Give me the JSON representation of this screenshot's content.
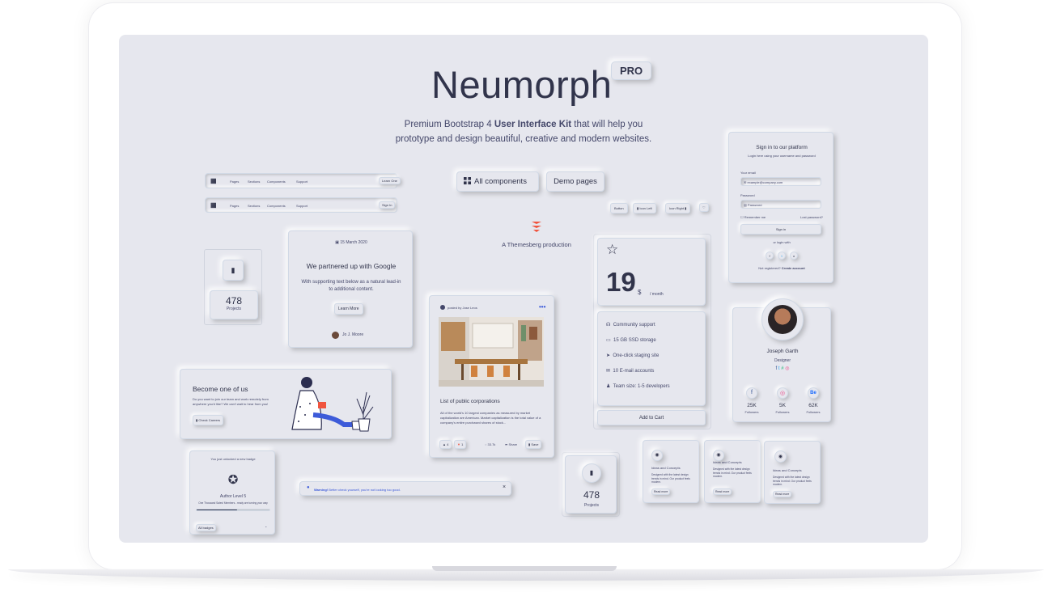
{
  "hero": {
    "title": "Neumorph",
    "badge": "PRO",
    "line1_a": "Premium Bootstrap 4 ",
    "line1_b": "User Interface Kit",
    "line1_c": " that will help you",
    "line2": "prototype and design beautiful, creative and modern websites."
  },
  "actions": {
    "all_components": "All components",
    "demo_pages": "Demo pages"
  },
  "navbar": {
    "items": [
      "Pages",
      "Sections",
      "Components",
      "Support"
    ],
    "learn": "Learn One",
    "signin": "Sign In"
  },
  "buttons": {
    "button": "Button",
    "icon_left": "Icon Left",
    "icon_right": "Icon Right"
  },
  "production": "A Themesberg production",
  "blog_card": {
    "date": "15 March 2020",
    "title": "We partnered up with Google",
    "text": "With supporting text below as a natural lead-in to additional content.",
    "cta": "Learn More",
    "author": "Jo J. Moore"
  },
  "counter": {
    "value": "478",
    "label": "Projects"
  },
  "careers": {
    "title": "Become one of us",
    "text": "Do you want to join our team and work remotely from anywhere you'd like? We can't wait to hear from you!",
    "cta": "Check Careers"
  },
  "post": {
    "by": "posted by Jose Leos",
    "title": "List of public corporations",
    "text": "All of the world's 10 largest companies as measured by market capitalization are American. Market capitalization is the total value of a company's entire purchased shares of stock...",
    "likes": "4",
    "dislikes": "1",
    "views": "33.7k",
    "share": "Share",
    "save": "Save"
  },
  "pricing": {
    "price": "19",
    "currency": "$",
    "period": "/ month",
    "features": [
      "Community support",
      "15 GB SSD storage",
      "One-click staging site",
      "10 E-mail accounts",
      "Team size: 1-5 developers"
    ],
    "cta": "Add to Cart"
  },
  "signin": {
    "title": "Sign in to our platform",
    "subtitle": "Login here using your username and password",
    "email_label": "Your email",
    "email_placeholder": "example@company.com",
    "password_label": "Password",
    "password_placeholder": "Password",
    "remember": "Remember me",
    "lost": "Lost password?",
    "submit": "Sign in",
    "or": "or login with",
    "not_registered": "Not registered?",
    "create": "Create account"
  },
  "profile": {
    "name": "Joseph Garth",
    "role": "Designer",
    "stats": [
      {
        "value": "25K",
        "label": "Followers"
      },
      {
        "value": "5K",
        "label": "Followers"
      },
      {
        "value": "62K",
        "label": "Followers"
      }
    ]
  },
  "badge_card": {
    "title": "You just unlocked a new badge",
    "level": "Author Level 5",
    "text": "One Thousand Sales! Members - ready are turning your way",
    "progress": 0.55,
    "footer": "All badges"
  },
  "alert": {
    "strong": "Warning!",
    "text": " Better check yourself, you're not looking too good."
  },
  "ideas": [
    {
      "title": "Ideas and Concepts",
      "text": "Designed with the latest design trends in mind. Our product feels modern.",
      "cta": "Read more"
    },
    {
      "title": "Ideas and Concepts",
      "text": "Designed with the latest design trends in mind. Our product feels modern.",
      "cta": "Read more"
    },
    {
      "title": "Ideas and Concepts",
      "text": "Designed with the latest design trends in mind. Our product feels modern.",
      "cta": "Read more"
    }
  ],
  "colors": {
    "bg": "#e6e7ee",
    "text": "#31344b",
    "primary": "#44476a",
    "accent": "#f0543e"
  }
}
